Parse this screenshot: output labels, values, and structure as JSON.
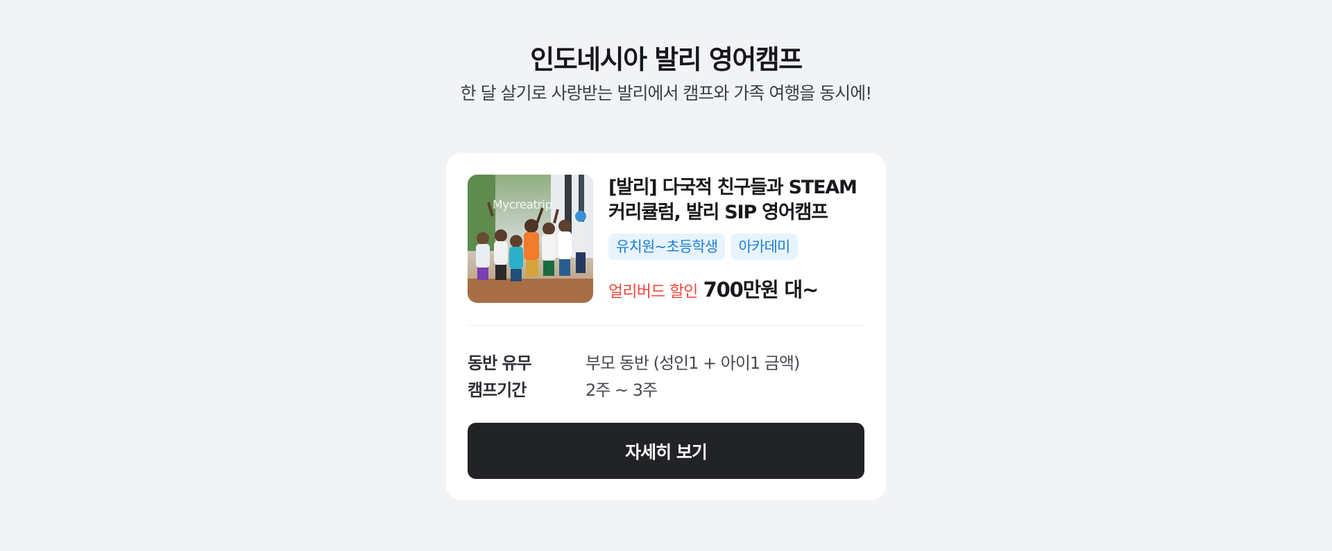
{
  "header": {
    "title": "인도네시아 발리 영어캠프",
    "subtitle": "한 달 살기로 사랑받는 발리에서 캠프와 가족 여행을 동시에!"
  },
  "card": {
    "thumbnail": {
      "watermark": "Mycreatrip",
      "icon": "group-photo-image"
    },
    "product_title": "[발리] 다국적 친구들과 STEAM 커리큘럼, 발리 SIP 영어캠프",
    "tags": [
      {
        "label": "유치원~초등학생"
      },
      {
        "label": "아카데미"
      }
    ],
    "discount_label": "얼리버드 할인",
    "price": "700만원 대~",
    "details": [
      {
        "label": "동반 유무",
        "value": "부모 동반 (성인1 + 아이1 금액)"
      },
      {
        "label": "캠프기간",
        "value": "2주 ~ 3주"
      }
    ],
    "cta_label": "자세히 보기"
  },
  "colors": {
    "background": "#f2f3f5",
    "tag_bg": "#e8f4fd",
    "tag_text": "#1c7fd6",
    "discount": "#f0483e",
    "cta_bg": "#212327"
  }
}
